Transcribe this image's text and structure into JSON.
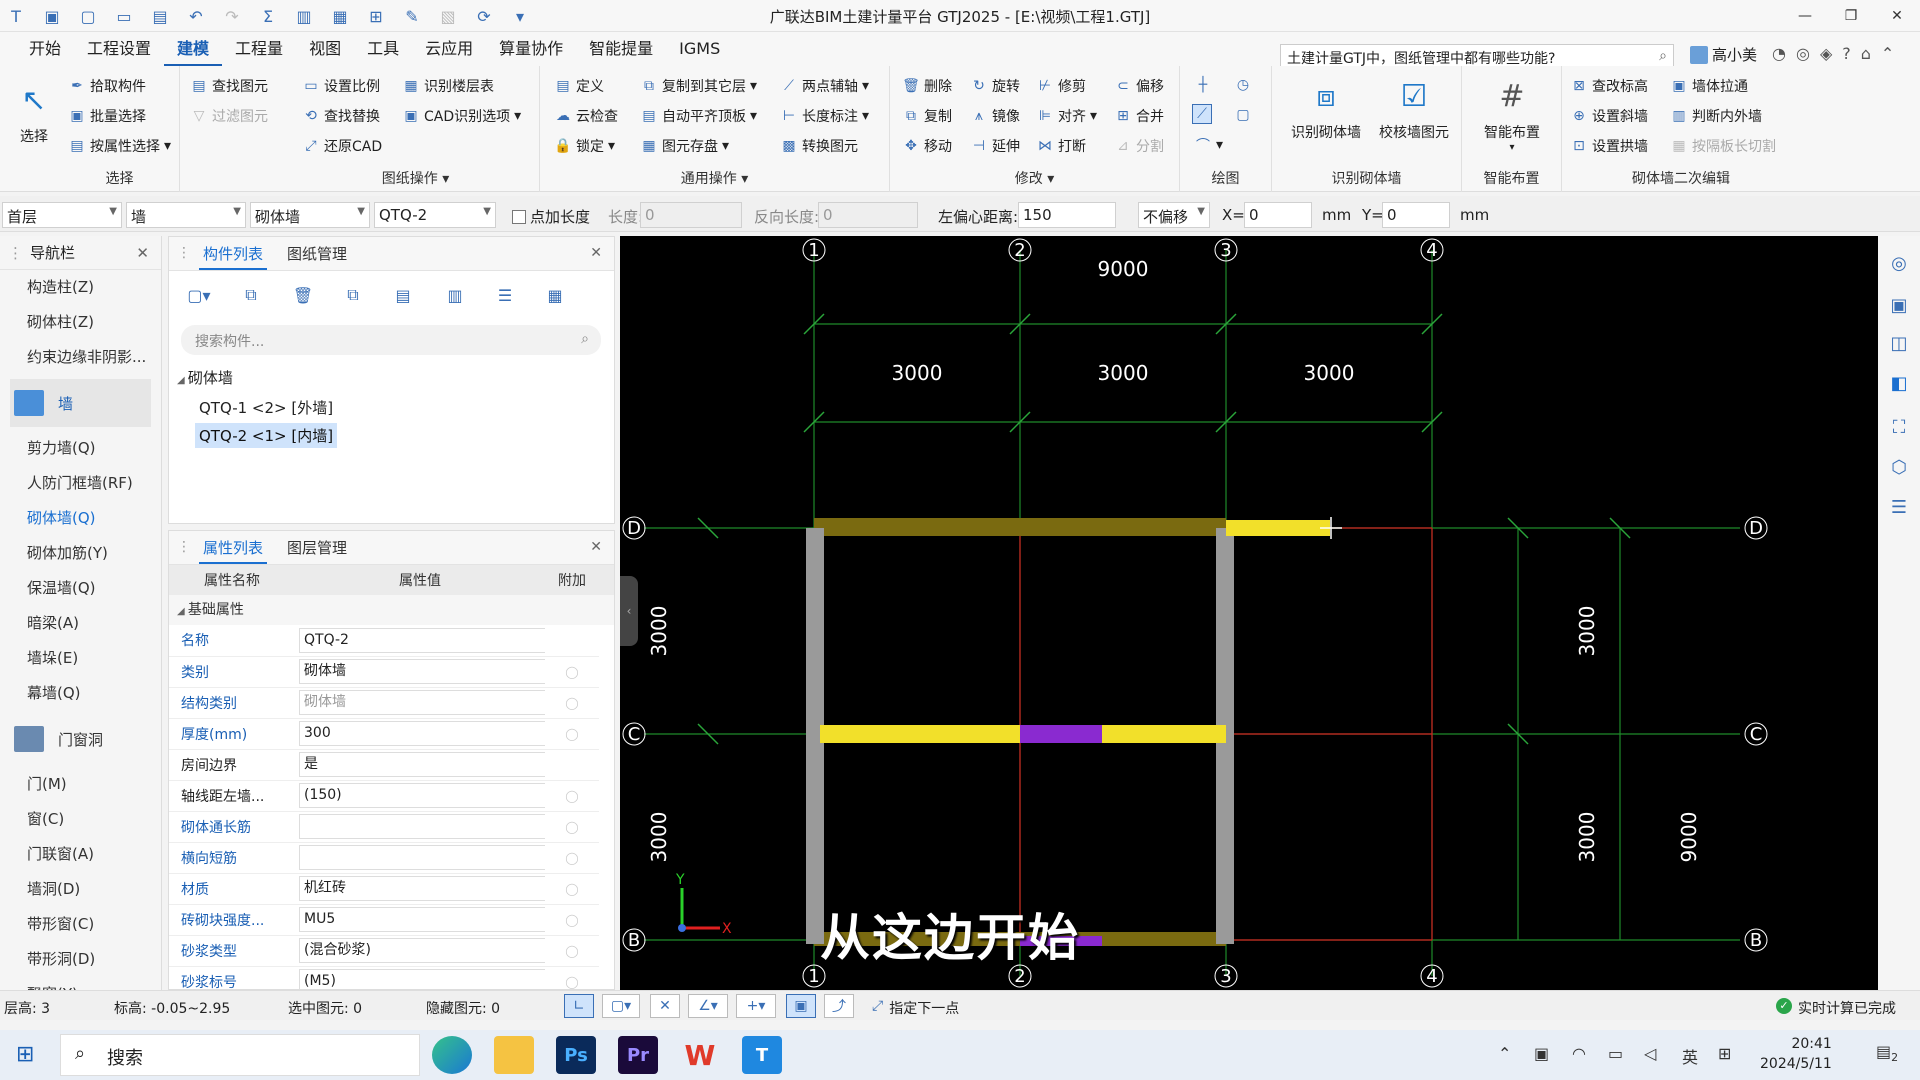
{
  "window": {
    "title": "广联达BIM土建计量平台 GTJ2025 - [E:\\视频\\工程1.GTJ]"
  },
  "menus": [
    "开始",
    "工程设置",
    "建模",
    "工程量",
    "视图",
    "工具",
    "云应用",
    "算量协作",
    "智能提量",
    "IGMS"
  ],
  "active_menu": "建模",
  "help_search": "土建计量GTJ中，图纸管理中都有哪些功能?",
  "user": "高小美",
  "ribbon": {
    "select": {
      "label": "选择",
      "group": "选择"
    },
    "g1": {
      "items": [
        "拾取构件",
        "批量选择",
        "按属性选择",
        "查找图元",
        "过滤图元"
      ]
    },
    "g2": {
      "items": [
        "设置比例",
        "识别楼层表",
        "查找替换",
        "CAD识别选项",
        "还原CAD"
      ],
      "group": "图纸操作"
    },
    "g3": {
      "items": [
        "定义",
        "复制到其它层",
        "两点辅轴",
        "云检查",
        "自动平齐顶板",
        "长度标注",
        "锁定",
        "图元存盘",
        "转换图元"
      ],
      "group": "通用操作"
    },
    "g4": {
      "items": [
        "删除",
        "旋转",
        "修剪",
        "偏移",
        "复制",
        "镜像",
        "对齐",
        "合并",
        "移动",
        "延伸",
        "打断",
        "分割"
      ],
      "group": "修改"
    },
    "g5": {
      "group": "绘图"
    },
    "g6": {
      "items": [
        "识别砌体墙",
        "校核墙图元"
      ],
      "group": "识别砌体墙"
    },
    "g7": {
      "items": [
        "智能布置"
      ],
      "group": "智能布置"
    },
    "g8": {
      "items": [
        "查改标高",
        "墙体拉通",
        "设置斜墙",
        "判断内外墙",
        "设置拱墙",
        "按隔板长切割"
      ],
      "group": "砌体墙二次编辑"
    }
  },
  "propbar": {
    "floor": "首层",
    "type": "墙",
    "subtype": "砌体墙",
    "component": "QTQ-2",
    "add_length": "点加长度",
    "length_label": "长度:",
    "length_val": "0",
    "rev_length_label": "反向长度:",
    "rev_length_val": "0",
    "offset_label": "左偏心距离:",
    "offset_val": "150",
    "offset_mode": "不偏移",
    "x_label": "X=",
    "x_val": "0",
    "x_unit": "mm",
    "y_label": "Y=",
    "y_val": "0",
    "y_unit": "mm"
  },
  "nav": {
    "title": "导航栏",
    "items": [
      "构造柱(Z)",
      "砌体柱(Z)",
      "约束边缘非阴影..."
    ],
    "cat1": "墙",
    "items2": [
      "剪力墙(Q)",
      "人防门框墙(RF)",
      "砌体墙(Q)",
      "砌体加筋(Y)",
      "保温墙(Q)",
      "暗梁(A)",
      "墙垛(E)",
      "幕墙(Q)"
    ],
    "cat2": "门窗洞",
    "items3": [
      "门(M)",
      "窗(C)",
      "门联窗(A)",
      "墙洞(D)",
      "带形窗(C)",
      "带形洞(D)",
      "飘窗(Y)"
    ]
  },
  "component_panel": {
    "tabs": [
      "构件列表",
      "图纸管理"
    ],
    "search_placeholder": "搜索构件...",
    "tree_root": "砌体墙",
    "tree_items": [
      "QTQ-1 <2> [外墙]",
      "QTQ-2 <1> [内墙]"
    ]
  },
  "property_panel": {
    "tabs": [
      "属性列表",
      "图层管理"
    ],
    "headers": [
      "属性名称",
      "属性值",
      "附加"
    ],
    "section": "基础属性",
    "rows": [
      [
        "名称",
        "QTQ-2"
      ],
      [
        "类别",
        "砌体墙"
      ],
      [
        "结构类别",
        "砌体墙"
      ],
      [
        "厚度(mm)",
        "300"
      ],
      [
        "房间边界",
        "是"
      ],
      [
        "轴线距左墙...",
        "(150)"
      ],
      [
        "砌体通长筋",
        ""
      ],
      [
        "横向短筋",
        ""
      ],
      [
        "材质",
        "机红砖"
      ],
      [
        "砖砌块强度...",
        "MU5"
      ],
      [
        "砂浆类型",
        "(混合砂浆)"
      ],
      [
        "砂浆标号",
        "(M5)"
      ]
    ]
  },
  "canvas": {
    "axes_top": [
      "1",
      "2",
      "3",
      "4"
    ],
    "axes_bottom": [
      "1",
      "2",
      "3",
      "4"
    ],
    "axes_side": [
      "D",
      "C",
      "B"
    ],
    "dims_top_total": "9000",
    "dims_top": [
      "3000",
      "3000",
      "3000"
    ],
    "dims_left": [
      "3000",
      "3000"
    ],
    "dims_right": [
      "3000",
      "3000"
    ],
    "dims_right_total": "9000",
    "subtitle": "从这边开始",
    "axis_x": "X",
    "axis_y": "Y"
  },
  "status": {
    "floor_height": "层高:  3",
    "elevation": "标高:  -0.05~2.95",
    "selected": "选中图元:  0",
    "hidden": "隐藏图元:  0",
    "hint": "指定下一点",
    "calc": "实时计算已完成"
  },
  "taskbar": {
    "search": "搜索",
    "ime": "英",
    "time": "20:41",
    "date": "2024/5/11",
    "notif": "2"
  }
}
